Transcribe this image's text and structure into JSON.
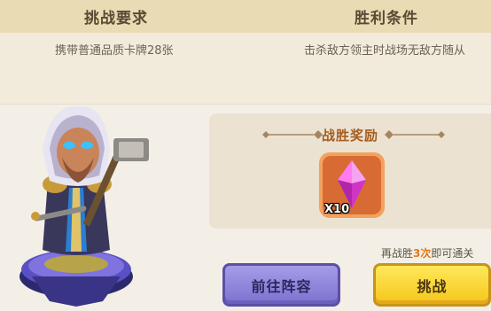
{
  "requirements": {
    "title": "挑战要求",
    "text": "携带普通品质卡牌28张"
  },
  "victory": {
    "title": "胜利条件",
    "text": "击杀敌方领主时战场无敌方随从"
  },
  "reward": {
    "title": "战胜奖励",
    "item_icon": "purple-crystal-icon",
    "item_count": "X10"
  },
  "hint": {
    "before": "再战胜",
    "highlight": "3次",
    "after": "即可通关"
  },
  "buttons": {
    "lineup_label": "前往阵容",
    "challenge_label": "挑战"
  },
  "colors": {
    "header_band": "#e9dbb3",
    "reward_title": "#a65d1f",
    "hint_highlight": "#e07a18",
    "lineup_button": "#8b81d9",
    "challenge_button": "#f9d632"
  }
}
